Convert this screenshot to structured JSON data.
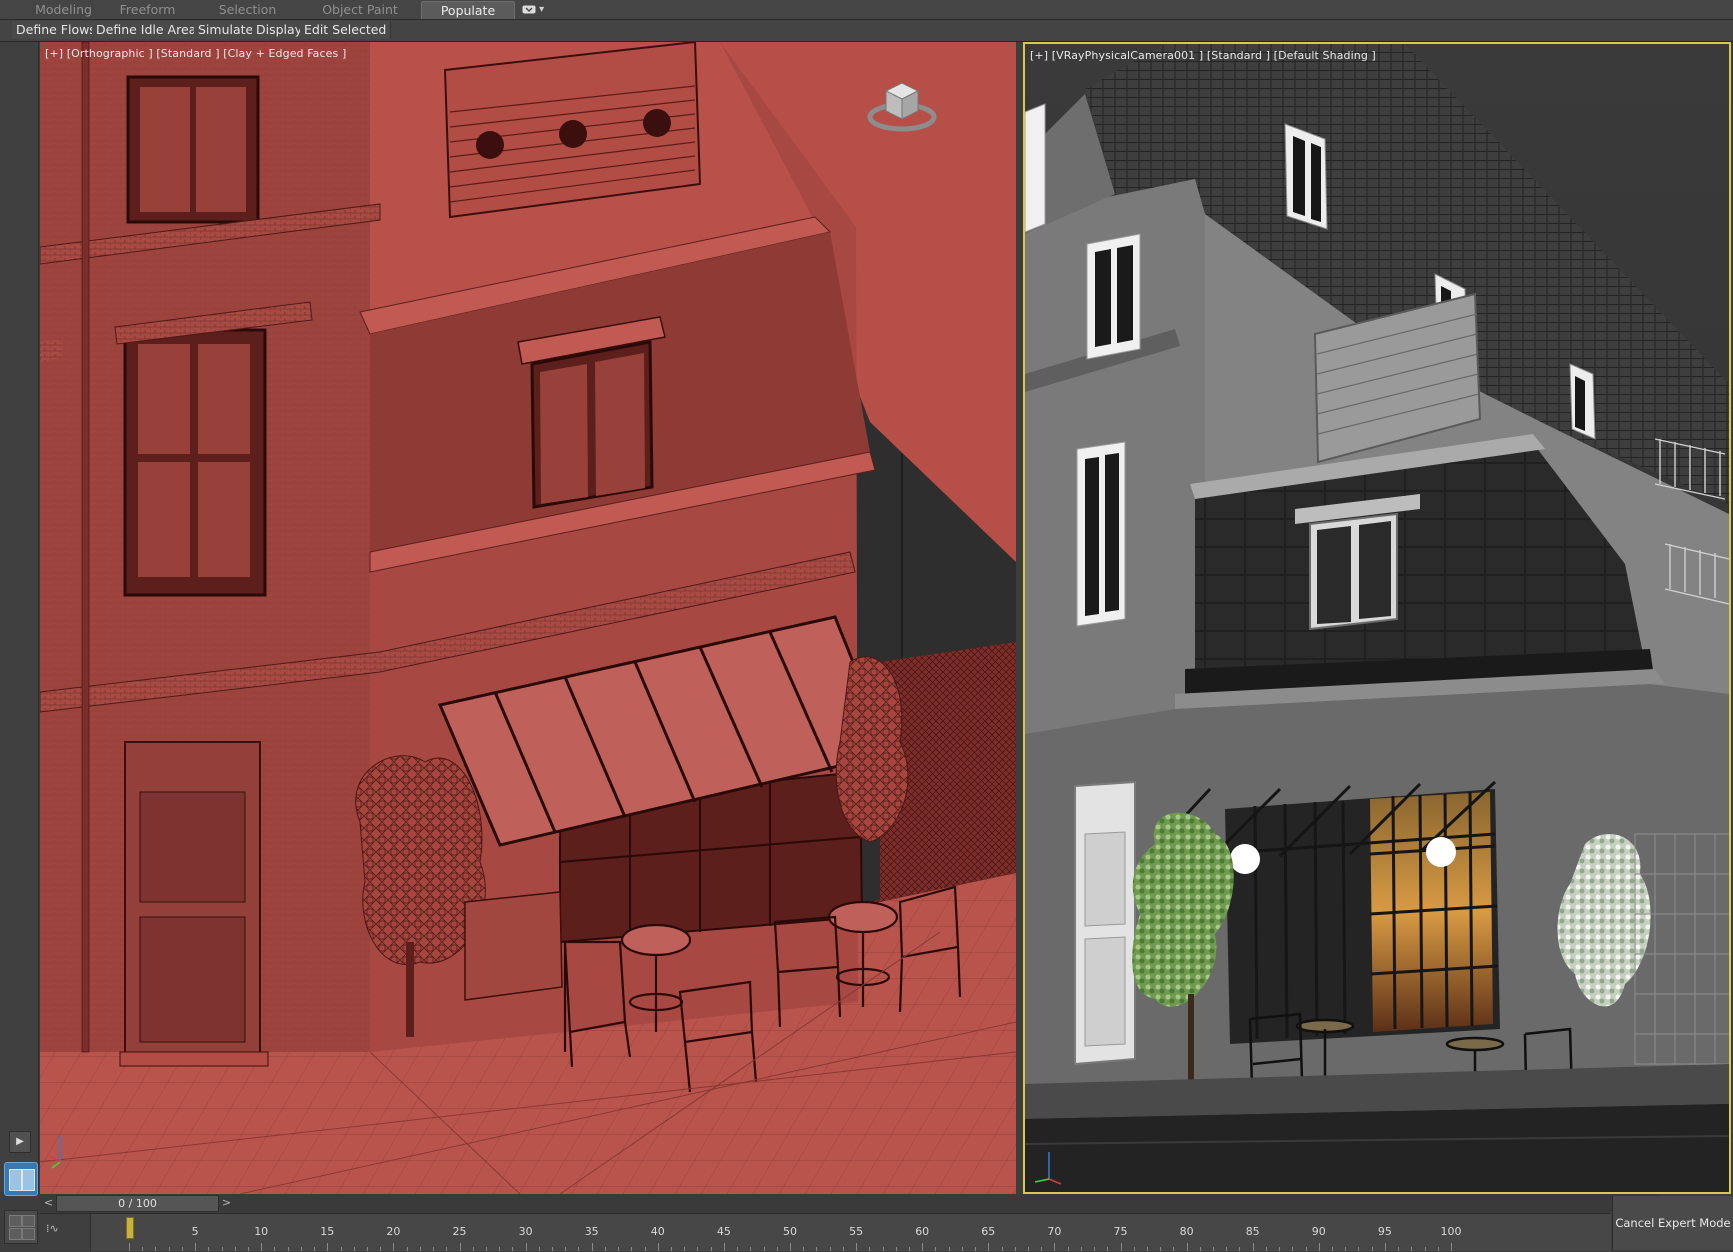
{
  "ribbon": {
    "tabs": [
      {
        "label": "Modeling",
        "active": false
      },
      {
        "label": "Freeform",
        "active": false
      },
      {
        "label": "Selection",
        "active": false
      },
      {
        "label": "Object Paint",
        "active": false
      },
      {
        "label": "Populate",
        "active": true
      }
    ],
    "menu_icon": "panel-toggle-icon",
    "menu_glyph": "▾"
  },
  "populate_toolbar": {
    "buttons": [
      "Define Flows",
      "Define Idle Areas",
      "Simulate",
      "Display",
      "Edit Selected"
    ]
  },
  "viewports": {
    "left": {
      "label": "[+] [Orthographic ] [Standard ] [Clay + Edged Faces ]",
      "clay_color": "#b5504a",
      "active": false
    },
    "right": {
      "label": "[+] [VRayPhysicalCamera001 ] [Standard ] [Default Shading ]",
      "active": true,
      "border_color": "#d7c94a"
    }
  },
  "left_strip": {
    "play_glyph": "▶",
    "play_icon": "play-icon",
    "layout_icons": [
      "two-viewport-layout-icon",
      "four-viewport-layout-icon"
    ]
  },
  "timeline": {
    "frame_display": "0 / 100",
    "prev_glyph": "<",
    "next_glyph": ">",
    "current_frame": 0,
    "total_frames": 100,
    "tick_labels": [
      "0",
      "5",
      "10",
      "15",
      "20",
      "25",
      "30",
      "35",
      "40",
      "45",
      "50",
      "55",
      "60",
      "65",
      "70",
      "75",
      "80",
      "85",
      "90",
      "95",
      "100"
    ],
    "curve_editor_glyph": "⁞∿"
  },
  "status": {
    "cancel_expert_mode": "Cancel Expert Mode"
  }
}
